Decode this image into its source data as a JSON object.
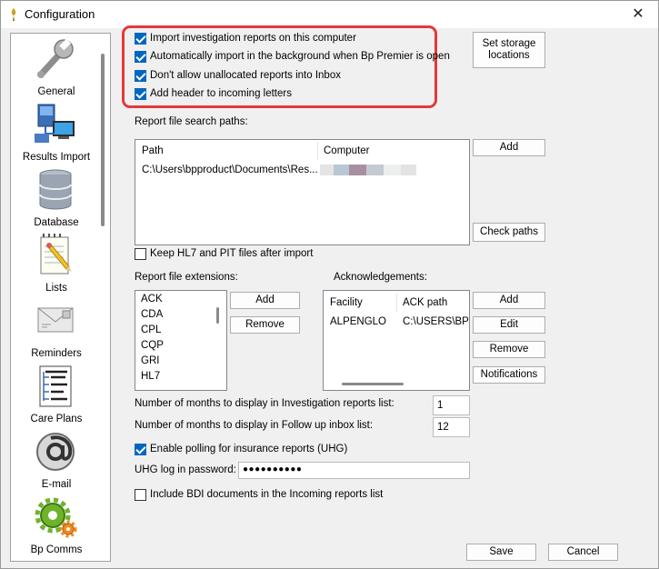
{
  "window": {
    "title": "Configuration",
    "close_glyph": "✕"
  },
  "sidebar": {
    "items": [
      {
        "label": "General",
        "icon": "wrench-icon"
      },
      {
        "label": "Results Import",
        "icon": "computer-network-icon"
      },
      {
        "label": "Database",
        "icon": "database-icon"
      },
      {
        "label": "Lists",
        "icon": "notepad-pencil-icon"
      },
      {
        "label": "Reminders",
        "icon": "envelope-icon"
      },
      {
        "label": "Care Plans",
        "icon": "care-plan-document-icon"
      },
      {
        "label": "E-mail",
        "icon": "at-sign-icon"
      },
      {
        "label": "Bp Comms",
        "icon": "gears-icon"
      }
    ]
  },
  "options": {
    "import_reports": "Import investigation reports on this computer",
    "auto_import": "Automatically import in the background when Bp Premier is open",
    "no_unallocated": "Don't allow unallocated reports into Inbox",
    "add_header": "Add header to incoming letters"
  },
  "set_storage": {
    "line1": "Set storage",
    "line2": "locations"
  },
  "search_paths": {
    "title": "Report file search paths:",
    "col_path": "Path",
    "col_computer": "Computer",
    "rows": [
      {
        "path": "C:\\Users\\bpproduct\\Documents\\Res..."
      }
    ],
    "add": "Add",
    "check": "Check paths"
  },
  "keep_files": "Keep HL7 and PIT files after import",
  "extensions": {
    "title": "Report file extensions:",
    "items": [
      "ACK",
      "CDA",
      "CPL",
      "CQP",
      "GRI",
      "HL7"
    ],
    "add": "Add",
    "remove": "Remove"
  },
  "acks": {
    "title": "Acknowledgements:",
    "col_facility": "Facility",
    "col_ack": "ACK path",
    "rows": [
      {
        "facility": "ALPENGLO",
        "ack_path": "C:\\USERS\\BP"
      }
    ],
    "add": "Add",
    "edit": "Edit",
    "remove": "Remove",
    "notifications": "Notifications"
  },
  "months_investigation": {
    "label": "Number of months to display in Investigation reports list:",
    "value": "1"
  },
  "months_followup": {
    "label": "Number of months to display in Follow up inbox list:",
    "value": "12"
  },
  "uhg_polling": "Enable polling for insurance reports (UHG)",
  "uhg_password": {
    "label": "UHG log in password:",
    "value": "●●●●●●●●●●"
  },
  "bdi_docs": "Include BDI documents in the Incoming reports list",
  "footer": {
    "save": "Save",
    "cancel": "Cancel"
  }
}
